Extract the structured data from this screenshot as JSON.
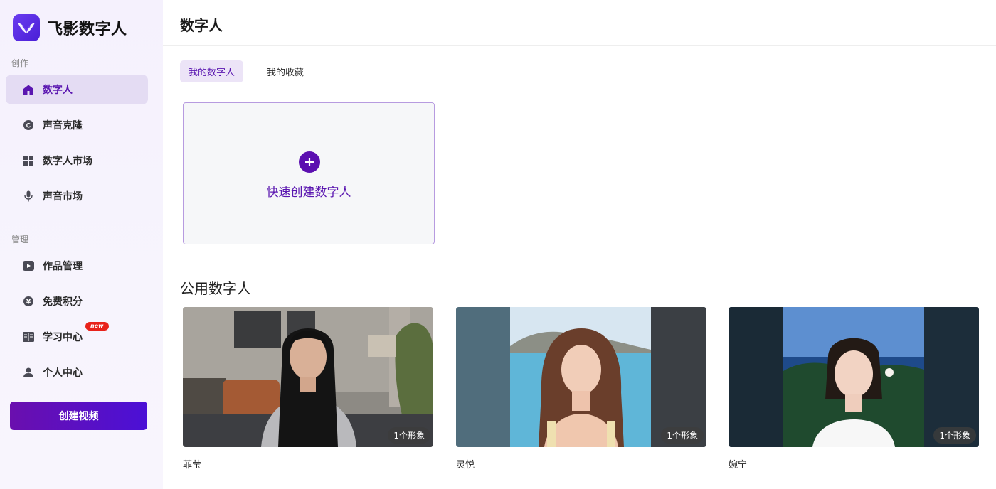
{
  "brand": {
    "name": "飞影数字人",
    "logo_icon": "wing-logo-icon"
  },
  "sidebar": {
    "section_create": "创作",
    "section_manage": "管理",
    "items": [
      {
        "label": "数字人",
        "icon": "home-icon",
        "active": true
      },
      {
        "label": "声音克隆",
        "icon": "copyright-icon"
      },
      {
        "label": "数字人市场",
        "icon": "grid-icon"
      },
      {
        "label": "声音市场",
        "icon": "microphone-icon"
      },
      {
        "label": "作品管理",
        "icon": "play-icon"
      },
      {
        "label": "免费积分",
        "icon": "yen-icon"
      },
      {
        "label": "学习中心",
        "icon": "book-icon",
        "badge": "new"
      },
      {
        "label": "个人中心",
        "icon": "user-icon"
      }
    ],
    "create_button": "创建视频"
  },
  "header": {
    "title": "数字人"
  },
  "tabs": [
    {
      "label": "我的数字人",
      "active": true
    },
    {
      "label": "我的收藏"
    }
  ],
  "quick_create": {
    "label": "快速创建数字人",
    "icon": "plus-icon"
  },
  "public_section": {
    "title": "公用数字人",
    "avatars": [
      {
        "name": "菲莹",
        "count": "1个形象"
      },
      {
        "name": "灵悦",
        "count": "1个形象"
      },
      {
        "name": "婉宁",
        "count": "1个形象"
      }
    ]
  },
  "colors": {
    "accent": "#5a16b0",
    "active_bg": "#e4dcf3",
    "badge": "#e8221b"
  }
}
